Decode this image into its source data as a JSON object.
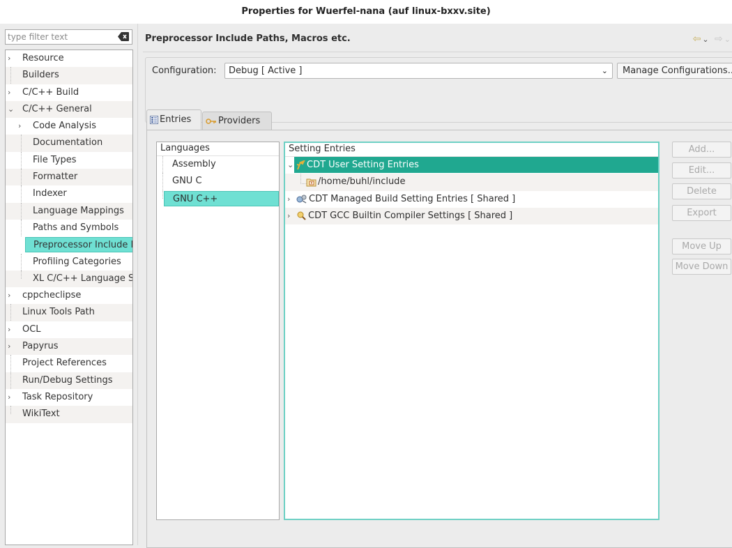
{
  "window": {
    "title": "Properties for Wuerfel-nana  (auf linux-bxxv.site)"
  },
  "filter": {
    "placeholder": "type filter text",
    "clear_icon": "clear-text-icon"
  },
  "sidebar": {
    "items": [
      {
        "label": "Resource",
        "expandable": true
      },
      {
        "label": "Builders",
        "expandable": false
      },
      {
        "label": "C/C++ Build",
        "expandable": true
      },
      {
        "label": "C/C++ General",
        "expandable": true,
        "expanded": true
      },
      {
        "label": "Code Analysis",
        "expandable": true,
        "child": true
      },
      {
        "label": "Documentation",
        "child": true
      },
      {
        "label": "File Types",
        "child": true
      },
      {
        "label": "Formatter",
        "child": true
      },
      {
        "label": "Indexer",
        "child": true
      },
      {
        "label": "Language Mappings",
        "child": true
      },
      {
        "label": "Paths and Symbols",
        "child": true
      },
      {
        "label": "Preprocessor Include Paths, Macros etc.",
        "child": true,
        "selected": true
      },
      {
        "label": "Profiling Categories",
        "child": true
      },
      {
        "label": "XL C/C++ Language Settings",
        "child": true
      },
      {
        "label": "cppcheclipse",
        "expandable": true
      },
      {
        "label": "Linux Tools Path"
      },
      {
        "label": "OCL",
        "expandable": true
      },
      {
        "label": "Papyrus",
        "expandable": true
      },
      {
        "label": "Project References"
      },
      {
        "label": "Run/Debug Settings"
      },
      {
        "label": "Task Repository",
        "expandable": true
      },
      {
        "label": "WikiText"
      }
    ]
  },
  "page": {
    "title": "Preprocessor Include Paths, Macros etc.",
    "nav": {
      "back_icon": "back-arrow-icon",
      "forward_icon": "forward-arrow-icon"
    }
  },
  "configuration": {
    "label": "Configuration:",
    "selected": "Debug  [ Active ]",
    "manage_label": "Manage Configurations..."
  },
  "tabs": [
    {
      "label": "Entries",
      "icon": "entries-icon",
      "active": true
    },
    {
      "label": "Providers",
      "icon": "providers-icon",
      "active": false
    }
  ],
  "languages": {
    "header": "Languages",
    "items": [
      "Assembly",
      "GNU C",
      "GNU C++"
    ],
    "selected_index": 2
  },
  "entries": {
    "header": "Setting Entries",
    "rows": [
      {
        "label": "CDT User Setting Entries",
        "icon": "user-settings-icon",
        "expanded": true,
        "selected": true
      },
      {
        "label": "/home/buhl/include",
        "icon": "include-folder-icon",
        "sub": true
      },
      {
        "label": "CDT Managed Build Setting Entries   [ Shared ]",
        "icon": "managed-build-icon",
        "expandable": true
      },
      {
        "label": "CDT GCC Builtin Compiler Settings   [ Shared ]",
        "icon": "gcc-builtin-icon",
        "expandable": true
      }
    ]
  },
  "actions": {
    "add": "Add...",
    "edit": "Edit...",
    "delete": "Delete",
    "export": "Export",
    "move_up": "Move Up",
    "move_down": "Move Down"
  },
  "colors": {
    "selection": "#6fe0d3",
    "entry_selection": "#20a890",
    "focus_border": "#6ed0c4"
  }
}
